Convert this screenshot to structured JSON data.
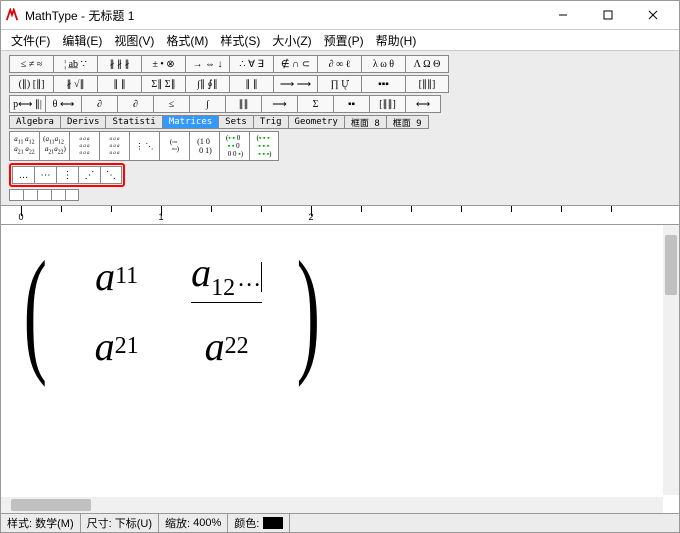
{
  "window": {
    "title": "MathType - 无标题 1"
  },
  "menu": {
    "file": "文件(F)",
    "edit": "编辑(E)",
    "view": "视图(V)",
    "format": "格式(M)",
    "style": "样式(S)",
    "size": "大小(Z)",
    "preset": "预置(P)",
    "help": "帮助(H)"
  },
  "toolbar": {
    "row1": [
      "≤ ≠ ≈",
      "¦ a̲b̲ ∵",
      "∦ ∦ ∦",
      "± • ⊗",
      "→ ⇔ ↓",
      "∴ ∀ ∃",
      "∉ ∩ ⊂",
      "∂ ∞ ℓ",
      "λ ω θ",
      "Λ Ω Θ"
    ],
    "row2": [
      "(∥) [∥]",
      "∦ √∥",
      "∥ ∥",
      "Σ∥ Σ∥",
      "∫∥ ∮∥",
      "∥ ∥",
      "⟶ ⟶",
      "∏ Ų̇",
      "▪▪▪",
      "[∥∥]"
    ],
    "row3": [
      "p⟷ ∥|",
      "θ ⟷",
      "∂",
      "∂",
      "≤",
      "∫",
      "∥∥",
      "⟶",
      "Σ",
      "▪▪",
      "[∥∥]",
      "⟷"
    ]
  },
  "tabs": {
    "items": [
      "Algebra",
      "Derivs",
      "Statisti",
      "Matrices",
      "Sets",
      "Trig",
      "Geometry",
      "框面 8",
      "框面 9"
    ],
    "active_index": 3
  },
  "matrix_palette": {
    "items": [
      "a11a12 a21a22",
      "(a11a12 a21a22)",
      "small4x4",
      "small4x4-b",
      "⋮⋱",
      "(mat)",
      "1 0 0 1",
      "green-a",
      "green-b"
    ]
  },
  "dots_palette": {
    "items": [
      "…",
      "⋯",
      "⋮",
      "⋰",
      "⋱"
    ]
  },
  "editor": {
    "matrix": {
      "r1c1_base": "a",
      "r1c1_sub": "11",
      "r1c2_base": "a",
      "r1c2_sub": "12",
      "r1c2_dots": "…",
      "r2c1_base": "a",
      "r2c1_sub": "21",
      "r2c2_base": "a",
      "r2c2_sub": "22"
    }
  },
  "status": {
    "style_label": "样式:",
    "style_value": "数学(M)",
    "size_label": "尺寸:",
    "size_value": "下标(U)",
    "zoom_label": "缩放:",
    "zoom_value": "400%",
    "color_label": "颜色:"
  },
  "ruler": {
    "marks": [
      "0",
      "1",
      "2"
    ]
  }
}
